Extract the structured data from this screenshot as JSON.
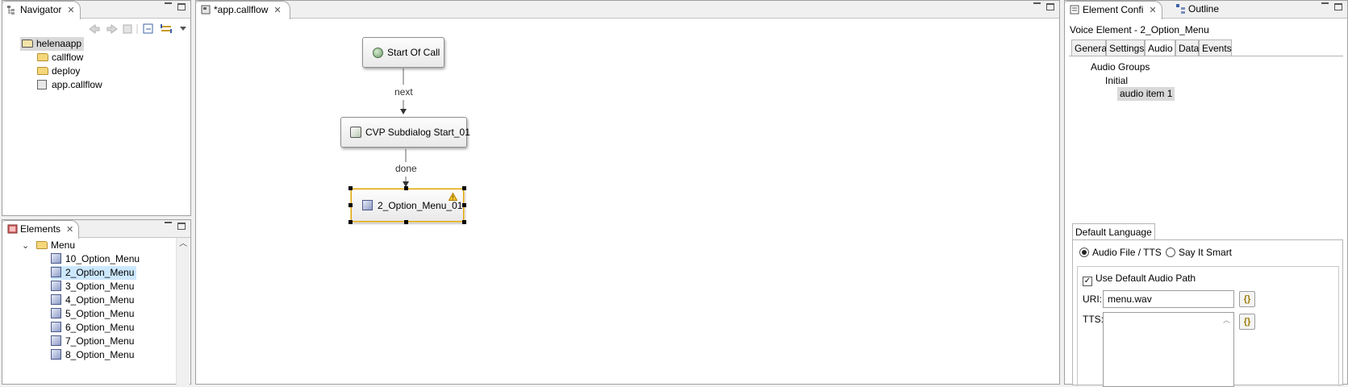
{
  "navigator": {
    "tab_label": "Navigator",
    "close": "✕",
    "toolbar_icons": [
      "back-icon",
      "forward-icon",
      "up-icon",
      "collapse-all-icon",
      "link-editor-icon",
      "view-menu-icon"
    ],
    "tree": [
      {
        "label": "helenaapp",
        "type": "project",
        "selected": true
      },
      {
        "label": "callflow",
        "type": "folder"
      },
      {
        "label": "deploy",
        "type": "folder"
      },
      {
        "label": "app.callflow",
        "type": "file"
      }
    ]
  },
  "elements": {
    "tab_label": "Elements",
    "close": "✕",
    "folder": "Menu",
    "items": [
      "10_Option_Menu",
      "2_Option_Menu",
      "3_Option_Menu",
      "4_Option_Menu",
      "5_Option_Menu",
      "6_Option_Menu",
      "7_Option_Menu",
      "8_Option_Menu"
    ],
    "selected_index": 1
  },
  "editor": {
    "tab_label": "*app.callflow",
    "close": "✕",
    "nodes": {
      "start": "Start Of Call",
      "subdialog": "CVP Subdialog Start_01",
      "menu": "2_Option_Menu_01"
    },
    "edges": {
      "next": "next",
      "done": "done"
    },
    "warning_icon": "warning-icon"
  },
  "config": {
    "tab_label": "Element Confi",
    "close": "✕",
    "outline_tab": "Outline",
    "element_title": "Voice Element - 2_Option_Menu",
    "tabs": [
      "General",
      "Settings",
      "Audio",
      "Data",
      "Events"
    ],
    "active_tab": "Audio",
    "audio_tree": {
      "root": "Audio Groups",
      "group": "Initial",
      "item": "audio item 1"
    },
    "default_language_tab": "Default Language",
    "radio_audio_file": "Audio File / TTS",
    "radio_say_it_smart": "Say It Smart",
    "use_default_path": "Use Default Audio Path",
    "uri_label": "URI:",
    "uri_value": "menu.wav",
    "tts_label": "TTS:",
    "tts_value": "",
    "var_button": "{}"
  },
  "colors": {
    "selection": "#cce8ff",
    "node_selected_border": "#e0a100",
    "panel_bg": "#f0f0f0"
  }
}
